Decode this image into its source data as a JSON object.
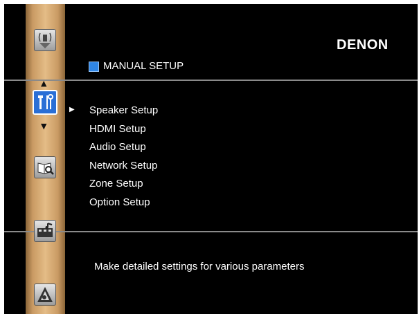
{
  "brand": "DENON",
  "screen_title": "MANUAL SETUP",
  "menu_items": [
    {
      "label": "Speaker Setup",
      "selected": true
    },
    {
      "label": "HDMI Setup",
      "selected": false
    },
    {
      "label": "Audio Setup",
      "selected": false
    },
    {
      "label": "Network Setup",
      "selected": false
    },
    {
      "label": "Zone Setup",
      "selected": false
    },
    {
      "label": "Option Setup",
      "selected": false
    }
  ],
  "description": "Make detailed settings for various parameters",
  "sidebar_icons": [
    "auto-setup-icon",
    "manual-setup-icon",
    "information-icon",
    "input-setup-icon",
    "quick-select-icon"
  ],
  "colors": {
    "accent": "#2f86e6",
    "active_icon": "#2a6fd6",
    "strip": "#e4bc86",
    "background": "#000000"
  }
}
